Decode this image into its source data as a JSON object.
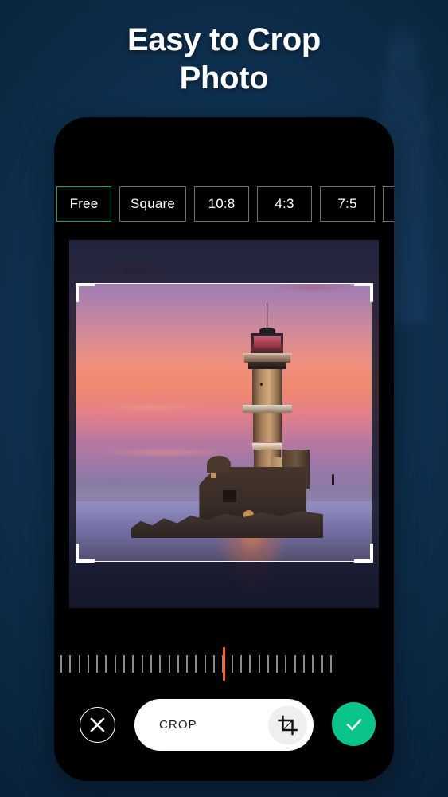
{
  "hero": {
    "title_line1": "Easy to Crop",
    "title_line2": "Photo",
    "title_color": "#ffffff",
    "background_color": "#0f3253",
    "background_icon": "lighthouse-silhouette"
  },
  "phone": {
    "screen_background": "#000000"
  },
  "ratio_bar": {
    "selected_index": 0,
    "selected_border_color": "#00a874",
    "unselected_border_color": "#6e7276",
    "tabs": [
      {
        "label": "Free"
      },
      {
        "label": "Square"
      },
      {
        "label": "10:8"
      },
      {
        "label": "4:3"
      },
      {
        "label": "7:5"
      },
      {
        "label": ""
      }
    ]
  },
  "canvas": {
    "photo_subject": "lighthouse-at-sunset",
    "crop_overlay_icon": "crop-corner-handles",
    "crop_frame_color": "#ffffff",
    "dim_overlay_color": "rgba(16,18,38,0.82)"
  },
  "ruler": {
    "icon": "rotation-ruler",
    "needle_color": "#f4662a",
    "tick_color": "#8b8b8b",
    "tick_count": 31,
    "needle_index": 15
  },
  "toolbar": {
    "close_icon": "close-x-icon",
    "crop_label": "CROP",
    "crop_icon": "crop-tool-icon",
    "confirm_icon": "check-icon",
    "confirm_color": "#0bc48a"
  }
}
